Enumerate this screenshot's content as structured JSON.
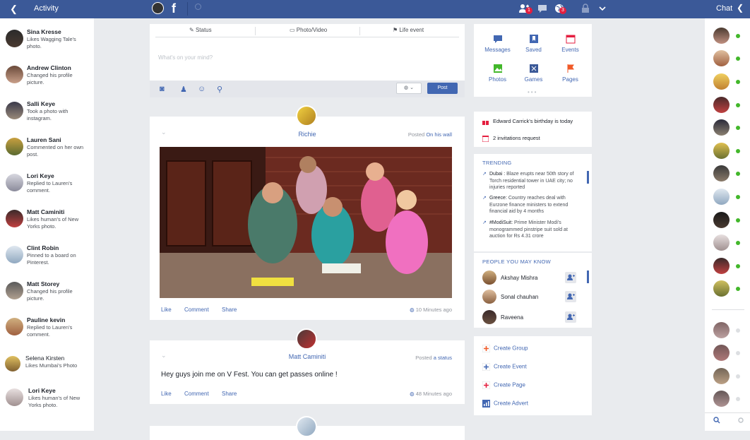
{
  "topbar": {
    "activity_title": "Activity",
    "chat_title": "Chat",
    "friend_requests_count": "1",
    "notifications_count": "3"
  },
  "activity": [
    {
      "name": "Sina Kresse",
      "desc": "Likes Wagging Tale's photo."
    },
    {
      "name": "Andrew Clinton",
      "desc": "Changed his profile picture."
    },
    {
      "name": "Salli Keye",
      "desc": "Took a photo with instagram."
    },
    {
      "name": "Lauren Sani",
      "desc": "Commented on her own post."
    },
    {
      "name": "Lori Keye",
      "desc": "Replied to Lauren's comment."
    },
    {
      "name": "Matt Caminiti",
      "desc": "Likes human's of New Yorks photo."
    },
    {
      "name": "Clint Robin",
      "desc": "Pinned to a board on Pinterest."
    },
    {
      "name": "Matt Storey",
      "desc": "Changed his profile picture."
    },
    {
      "name": "Pauline kevin",
      "desc": "Replied to Lauren's comment."
    },
    {
      "name": "Selena Kirsten",
      "desc": "Likes Mumbai's Photo"
    },
    {
      "name": "Lori Keye",
      "desc": "Likes human's of New Yorks photo."
    }
  ],
  "composer": {
    "tab_status": "Status",
    "tab_photo": "Photo/Video",
    "tab_life": "Life event",
    "placeholder": "What's on your mind?",
    "post_button": "Post"
  },
  "posts": [
    {
      "author": "Richie",
      "meta_prefix": "Posted",
      "meta_link": "On his wall",
      "like": "Like",
      "comment": "Comment",
      "share": "Share",
      "time": "10 Minutes ago"
    },
    {
      "author": "Matt Caminiti",
      "meta_prefix": "Posted",
      "meta_link": "a status",
      "text": "Hey guys join me on V Fest. You can get passes online !",
      "like": "Like",
      "comment": "Comment",
      "share": "Share",
      "time": "48 Minutes ago"
    }
  ],
  "shortcuts": [
    "Messages",
    "Saved",
    "Events",
    "Photos",
    "Games",
    "Pages"
  ],
  "events_panel": {
    "birthday_name": "Edward Carrick's",
    "birthday_suffix": "birthday is today",
    "invitations": "2 invitations request",
    "calendar_day": "17"
  },
  "trending": {
    "heading": "TRENDING",
    "items": [
      {
        "tag": "Dubai :",
        "text": "Blaze erupts near 50th story of Torch residential tower in UAE city; no injuries reported"
      },
      {
        "tag": "Greece:",
        "text": "Country reaches deal with Eurzone finance ministers to extend financial aid by 4 months"
      },
      {
        "tag": "#ModiSuit:",
        "text": "Prime Minister Modi's monogrammed pinstripe suit sold at auction for Rs 4.31 crore"
      }
    ]
  },
  "people": {
    "heading": "PEOPLE YOU MAY KNOW",
    "items": [
      "Akshay Mishra",
      "Sonal chauhan",
      "Raveena"
    ]
  },
  "create": [
    "Create Group",
    "Create Event",
    "Create Page",
    "Create Advert"
  ],
  "colors": {
    "brand": "#3b5998",
    "link": "#4267b2",
    "online": "#42b72a",
    "badge": "#e41e3f"
  }
}
